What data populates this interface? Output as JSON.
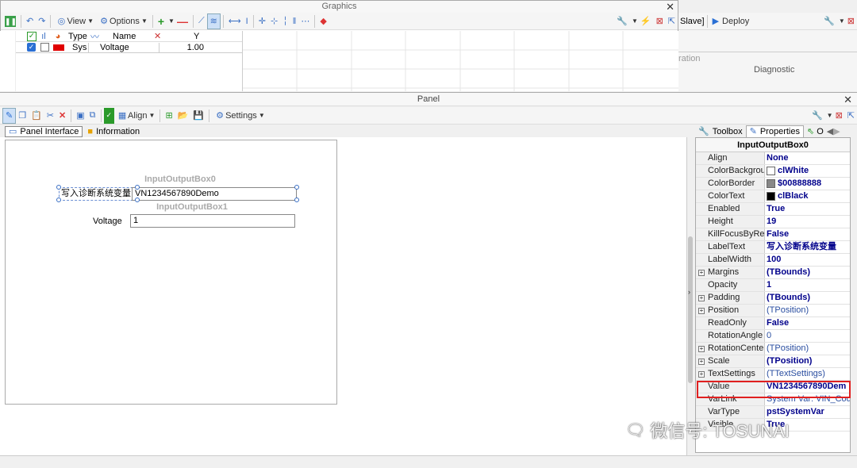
{
  "graphics": {
    "title": "Graphics",
    "toolbar": {
      "view": "View",
      "options": "Options"
    },
    "columns": {
      "type": "Type",
      "name": "Name",
      "y": "Y"
    },
    "row": {
      "type": "Sys",
      "name": "Voltage",
      "y": "1.00",
      "color": "#e00000"
    }
  },
  "right_top": {
    "slave_label": "Slave]",
    "deploy": "Deploy",
    "tab_partial": "ration",
    "diagnostic": "Diagnostic"
  },
  "panel": {
    "title": "Panel",
    "toolbar": {
      "align": "Align",
      "settings": "Settings"
    },
    "tabs": {
      "interface": "Panel Interface",
      "information": "Information"
    },
    "controls": {
      "box0_caption": "InputOutputBox0",
      "box0_label": "写入诊断系统变量",
      "box0_value": "VN1234567890Demo",
      "box1_caption": "InputOutputBox1",
      "box1_label": "Voltage",
      "box1_value": "1"
    }
  },
  "properties": {
    "tabs": {
      "toolbox": "Toolbox",
      "properties": "Properties",
      "extra": "O"
    },
    "header": "InputOutputBox0",
    "rows": [
      {
        "name": "Align",
        "value": "None"
      },
      {
        "name": "ColorBackgrour",
        "value": "clWhite",
        "swatch": "#ffffff"
      },
      {
        "name": "ColorBorder",
        "value": "$00888888",
        "swatch": "#888888"
      },
      {
        "name": "ColorText",
        "value": "clBlack",
        "swatch": "#000000"
      },
      {
        "name": "Enabled",
        "value": "True"
      },
      {
        "name": "Height",
        "value": "19"
      },
      {
        "name": "KillFocusByRetu",
        "value": "False"
      },
      {
        "name": "LabelText",
        "value": "写入诊断系统变量"
      },
      {
        "name": "LabelWidth",
        "value": "100"
      },
      {
        "name": "Margins",
        "value": "(TBounds)",
        "expand": true
      },
      {
        "name": "Opacity",
        "value": "1"
      },
      {
        "name": "Padding",
        "value": "(TBounds)",
        "expand": true
      },
      {
        "name": "Position",
        "value": "(TPosition)",
        "expand": true,
        "normal": true
      },
      {
        "name": "ReadOnly",
        "value": "False"
      },
      {
        "name": "RotationAngle",
        "value": "0",
        "normal": true
      },
      {
        "name": "RotationCenter",
        "value": "(TPosition)",
        "expand": true,
        "normal": true
      },
      {
        "name": "Scale",
        "value": "(TPosition)",
        "expand": true
      },
      {
        "name": "TextSettings",
        "value": "(TTextSettings)",
        "expand": true,
        "normal": true
      },
      {
        "name": "Value",
        "value": "VN1234567890Dem"
      },
      {
        "name": "VarLink",
        "value": "System Var: VIN_Code",
        "normal": true
      },
      {
        "name": "VarType",
        "value": "pstSystemVar"
      },
      {
        "name": "Visible",
        "value": "True"
      }
    ]
  },
  "watermark": "微信号: TOSUNAI"
}
